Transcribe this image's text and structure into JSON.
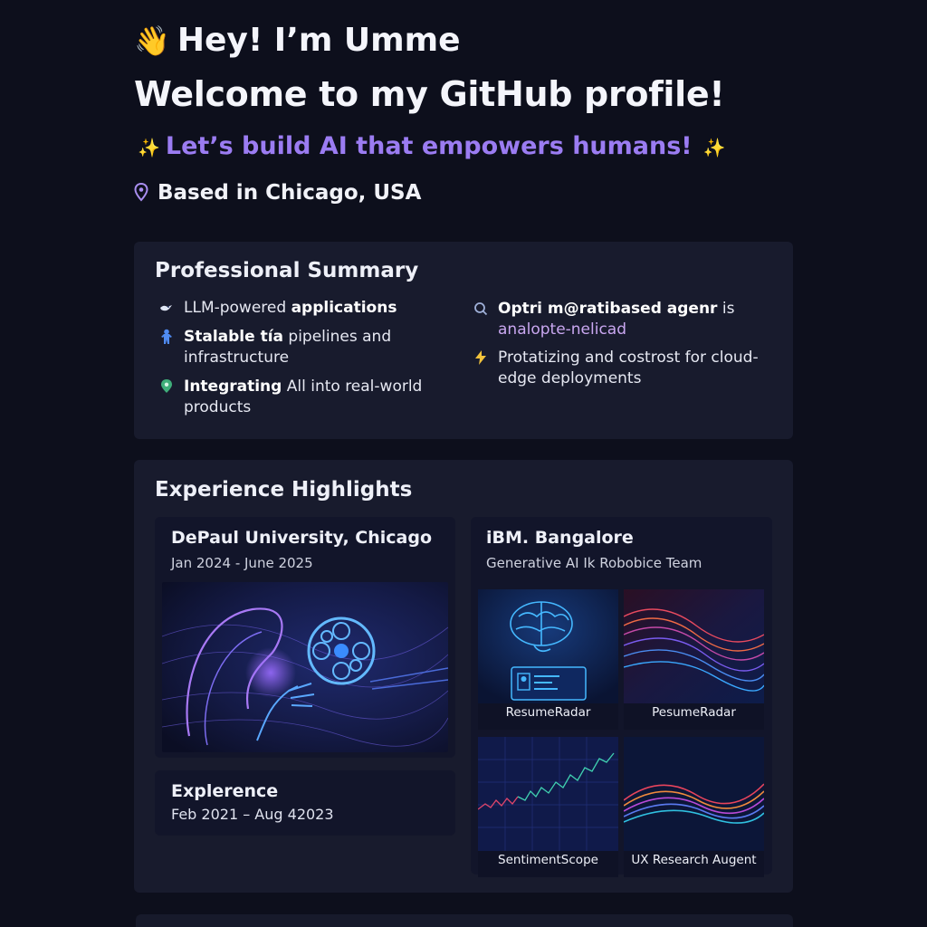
{
  "header": {
    "greeting_emoji": "👋",
    "greeting": "Hey! I’m Umme",
    "welcome": "Welcome to my GitHub profile!",
    "tagline": "Let’s build AI that empowers humans!",
    "location": "Based in Chicago, USA"
  },
  "colors": {
    "background": "#0d0f1c",
    "card": "#181b2d",
    "accent_purple": "#9b7cf2",
    "sparkle_yellow": "#f5d76e"
  },
  "summary": {
    "title": "Professional Summary",
    "items": [
      {
        "icon": "bird-icon",
        "bold": "",
        "prefix": "LLM-powered ",
        "strong": "applications",
        "rest": ""
      },
      {
        "icon": "person-icon",
        "strong": "Stalable tía",
        "rest": " pipelines and infrastructure"
      },
      {
        "icon": "pin-icon",
        "strong": "Integrating",
        "rest": " All into real-world products"
      },
      {
        "icon": "search-icon",
        "strong": "Optri m@ratibased agenr",
        "rest": " is",
        "sub": "analopte-nelicad"
      },
      {
        "icon": "lightning-icon",
        "strong": "",
        "rest": "Protatizing and costrost for cloud-edge deployments"
      }
    ]
  },
  "experience": {
    "title": "Experience Highlights",
    "depaul": {
      "title": "DePaul University, Chicago",
      "dates": "Jan 2024 - June 2025"
    },
    "exp2": {
      "title": "Explerence",
      "dates": "Feb 2021 – Aug 42023"
    },
    "ibm": {
      "title": "iBM. Bangalore",
      "team": "Generative AI Ik Robobice Team",
      "projects": [
        "ResumeRadar",
        "PesumeRadar",
        "SentimentScope",
        "UX Research Augent"
      ]
    }
  }
}
